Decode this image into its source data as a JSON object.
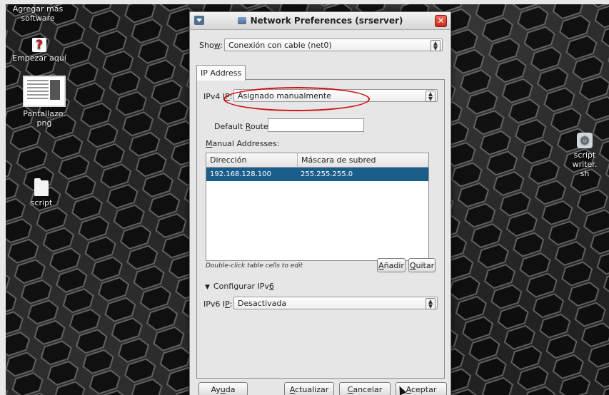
{
  "desktop": {
    "icons": [
      {
        "label": "Agregar más\nsoftware",
        "icon": "software-icon"
      },
      {
        "label": "Empezar aquí",
        "icon": "question-icon"
      },
      {
        "label": "Pantallazo.\npng",
        "icon": "image-thumbnail-icon"
      },
      {
        "label": "script",
        "icon": "file-icon"
      },
      {
        "label": "script writer.\nsh",
        "icon": "script-file-icon"
      }
    ]
  },
  "window": {
    "title": "Network Preferences (srserver)",
    "show_label": "Show:",
    "show_value": "Conexión con cable (net0)",
    "tab_label": "IP Address",
    "ipv4_label": "IPv4 IP:",
    "ipv4_value": "Asignado manualmente",
    "default_route_label": "Default Route:",
    "default_route_value": "",
    "manual_addresses_label": "Manual Addresses:",
    "table": {
      "columns": [
        "Dirección",
        "Máscara de subred"
      ],
      "rows": [
        [
          "192.168.128.100",
          "255.255.255.0"
        ]
      ]
    },
    "table_hint": "Double-click table cells to edit",
    "add_button": "Añadir",
    "remove_button": "Quitar",
    "ipv6_expander": "Configurar IPv6",
    "ipv6_label": "IPv6 IP:",
    "ipv6_value": "Desactivada",
    "buttons": {
      "help": "Ayuda",
      "update": "Actualizar",
      "cancel": "Cancelar",
      "accept": "Aceptar"
    }
  },
  "colors": {
    "selection": "#1b5e8c",
    "annotation_ellipse": "#d01010",
    "close_button": "#d8402f"
  }
}
